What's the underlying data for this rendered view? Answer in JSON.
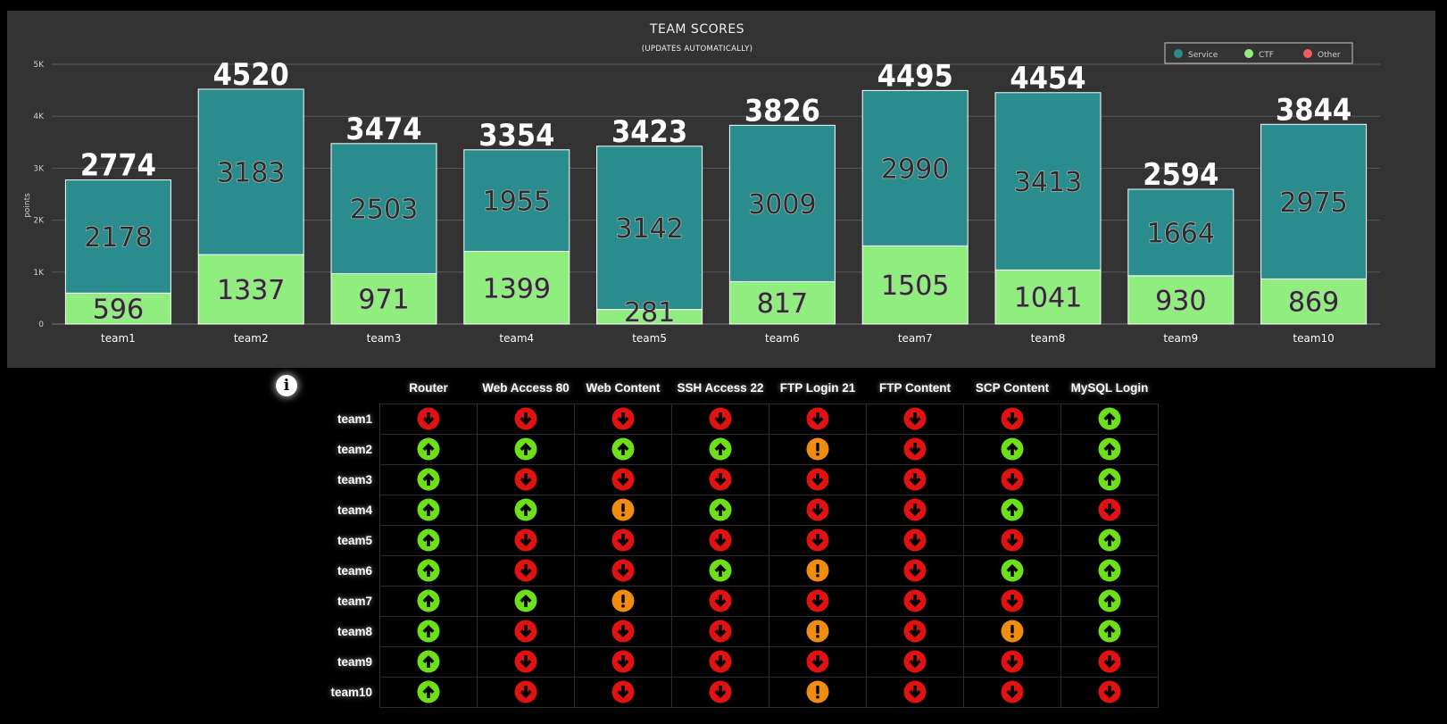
{
  "chart_data": {
    "type": "bar",
    "stacked": true,
    "title": "TEAM SCORES",
    "subtitle": "(UPDATES AUTOMATICALLY)",
    "ylabel": "points",
    "xlabel": "",
    "ylim": [
      0,
      5000
    ],
    "y_ticks": [
      "0",
      "1K",
      "2K",
      "3K",
      "4K",
      "5K"
    ],
    "grid": true,
    "legend_position": "top-right",
    "categories": [
      "team1",
      "team2",
      "team3",
      "team4",
      "team5",
      "team6",
      "team7",
      "team8",
      "team9",
      "team10"
    ],
    "series": [
      {
        "name": "Service",
        "color": "#2a8c8c",
        "values": [
          2178,
          3183,
          2503,
          1955,
          3142,
          3009,
          2990,
          3413,
          1664,
          2975
        ]
      },
      {
        "name": "CTF",
        "color": "#90ee7e",
        "values": [
          596,
          1337,
          971,
          1399,
          281,
          817,
          1505,
          1041,
          930,
          869
        ]
      },
      {
        "name": "Other",
        "color": "#f45b5b",
        "values": [
          0,
          0,
          0,
          0,
          0,
          0,
          0,
          0,
          0,
          0
        ]
      }
    ],
    "totals": [
      2774,
      4520,
      3474,
      3354,
      3423,
      3826,
      4495,
      4454,
      2594,
      3844
    ]
  },
  "status_table": {
    "info_icon": "info-icon",
    "columns": [
      "Router",
      "Web Access 80",
      "Web Content",
      "SSH Access 22",
      "FTP Login 21",
      "FTP Content",
      "SCP Content",
      "MySQL Login"
    ],
    "status_colors": {
      "up": "#6ee01a",
      "down": "#e01212",
      "warn": "#f08c0f"
    },
    "rows": [
      {
        "team": "team1",
        "status": [
          "down",
          "down",
          "down",
          "down",
          "down",
          "down",
          "down",
          "up"
        ]
      },
      {
        "team": "team2",
        "status": [
          "up",
          "up",
          "up",
          "up",
          "warn",
          "down",
          "up",
          "up"
        ]
      },
      {
        "team": "team3",
        "status": [
          "up",
          "down",
          "down",
          "down",
          "down",
          "down",
          "down",
          "up"
        ]
      },
      {
        "team": "team4",
        "status": [
          "up",
          "up",
          "warn",
          "up",
          "down",
          "down",
          "up",
          "down"
        ]
      },
      {
        "team": "team5",
        "status": [
          "up",
          "down",
          "down",
          "down",
          "down",
          "down",
          "down",
          "up"
        ]
      },
      {
        "team": "team6",
        "status": [
          "up",
          "down",
          "down",
          "up",
          "warn",
          "down",
          "up",
          "up"
        ]
      },
      {
        "team": "team7",
        "status": [
          "up",
          "up",
          "warn",
          "down",
          "down",
          "down",
          "down",
          "up"
        ]
      },
      {
        "team": "team8",
        "status": [
          "up",
          "down",
          "down",
          "down",
          "warn",
          "down",
          "warn",
          "up"
        ]
      },
      {
        "team": "team9",
        "status": [
          "up",
          "down",
          "down",
          "down",
          "down",
          "down",
          "down",
          "down"
        ]
      },
      {
        "team": "team10",
        "status": [
          "up",
          "down",
          "down",
          "down",
          "warn",
          "down",
          "down",
          "down"
        ]
      }
    ]
  }
}
